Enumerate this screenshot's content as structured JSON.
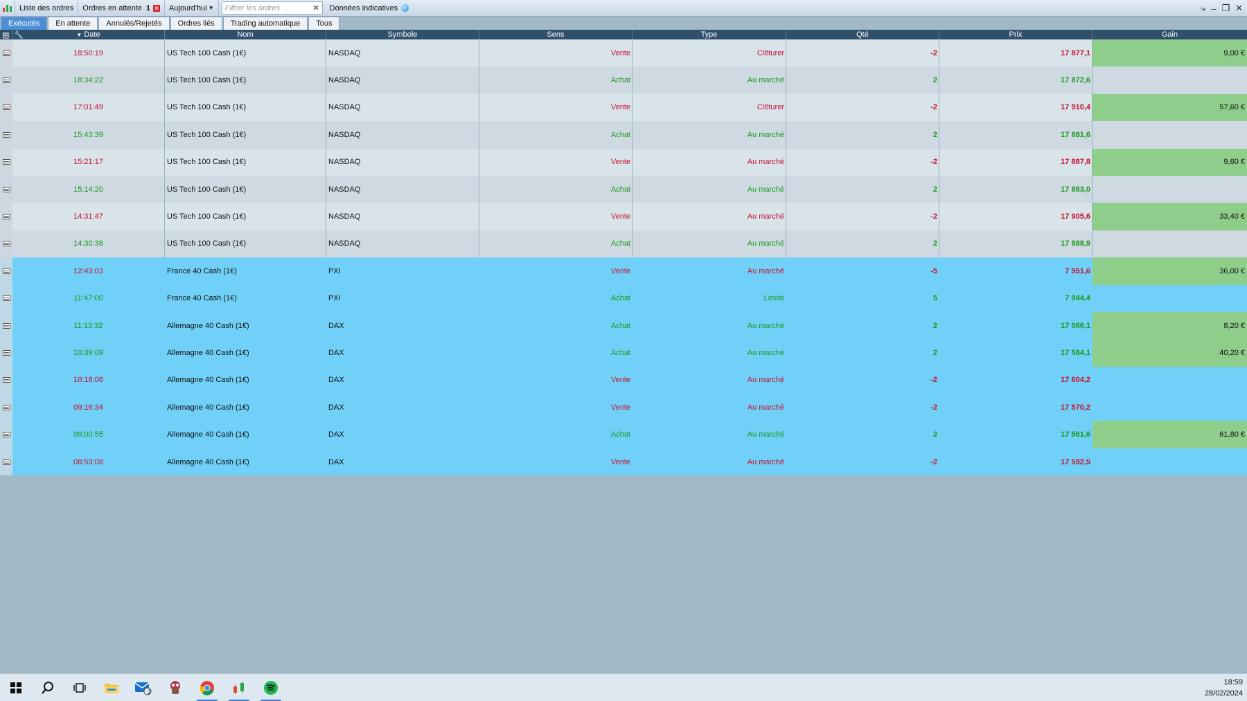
{
  "toolbar": {
    "orders_list": "Liste des ordres",
    "pending_orders": "Ordres en attente",
    "pending_count": "1",
    "period": "Aujourd'hui",
    "filter_placeholder": "Filtrer les ordres ...",
    "data_mode": "Données indicatives"
  },
  "tabs": [
    "Exécutés",
    "En attente",
    "Annulés/Rejetés",
    "Ordres liés",
    "Trading automatique",
    "Tous"
  ],
  "columns": {
    "date": "Date",
    "nom": "Nom",
    "symbole": "Symbole",
    "sens": "Sens",
    "type": "Type",
    "qte": "Qté",
    "prix": "Prix",
    "gain": "Gain"
  },
  "rows": [
    {
      "date": "18:50:19",
      "nom": "US Tech 100 Cash (1€)",
      "symbole": "NASDAQ",
      "sens": "Vente",
      "type": "Clôturer",
      "qte": "-2",
      "prix": "17 877,1",
      "gain": "9,00 €",
      "group": "nasdaq"
    },
    {
      "date": "18:34:22",
      "nom": "US Tech 100 Cash (1€)",
      "symbole": "NASDAQ",
      "sens": "Achat",
      "type": "Au marché",
      "qte": "2",
      "prix": "17 872,6",
      "gain": "",
      "group": "nasdaq"
    },
    {
      "date": "17:01:49",
      "nom": "US Tech 100 Cash (1€)",
      "symbole": "NASDAQ",
      "sens": "Vente",
      "type": "Clôturer",
      "qte": "-2",
      "prix": "17 910,4",
      "gain": "57,60 €",
      "group": "nasdaq"
    },
    {
      "date": "15:43:39",
      "nom": "US Tech 100 Cash (1€)",
      "symbole": "NASDAQ",
      "sens": "Achat",
      "type": "Au marché",
      "qte": "2",
      "prix": "17 881,6",
      "gain": "",
      "group": "nasdaq"
    },
    {
      "date": "15:21:17",
      "nom": "US Tech 100 Cash (1€)",
      "symbole": "NASDAQ",
      "sens": "Vente",
      "type": "Au marché",
      "qte": "-2",
      "prix": "17 887,8",
      "gain": "9,60 €",
      "group": "nasdaq"
    },
    {
      "date": "15:14:20",
      "nom": "US Tech 100 Cash (1€)",
      "symbole": "NASDAQ",
      "sens": "Achat",
      "type": "Au marché",
      "qte": "2",
      "prix": "17 883,0",
      "gain": "",
      "group": "nasdaq"
    },
    {
      "date": "14:31:47",
      "nom": "US Tech 100 Cash (1€)",
      "symbole": "NASDAQ",
      "sens": "Vente",
      "type": "Au marché",
      "qte": "-2",
      "prix": "17 905,6",
      "gain": "33,40 €",
      "group": "nasdaq"
    },
    {
      "date": "14:30:38",
      "nom": "US Tech 100 Cash (1€)",
      "symbole": "NASDAQ",
      "sens": "Achat",
      "type": "Au marché",
      "qte": "2",
      "prix": "17 888,9",
      "gain": "",
      "group": "nasdaq"
    },
    {
      "date": "12:43:03",
      "nom": "France 40 Cash (1€)",
      "symbole": "PXI",
      "sens": "Vente",
      "type": "Au marché",
      "qte": "-5",
      "prix": "7 951,6",
      "gain": "36,00 €",
      "group": "eu"
    },
    {
      "date": "11:47:00",
      "nom": "France 40 Cash (1€)",
      "symbole": "PXI",
      "sens": "Achat",
      "type": "Limite",
      "qte": "5",
      "prix": "7 944,4",
      "gain": "",
      "group": "eu"
    },
    {
      "date": "11:13:32",
      "nom": "Allemagne 40 Cash (1€)",
      "symbole": "DAX",
      "sens": "Achat",
      "type": "Au marché",
      "qte": "2",
      "prix": "17 566,1",
      "gain": "8,20 €",
      "group": "eu"
    },
    {
      "date": "10:39:09",
      "nom": "Allemagne 40 Cash (1€)",
      "symbole": "DAX",
      "sens": "Achat",
      "type": "Au marché",
      "qte": "2",
      "prix": "17 584,1",
      "gain": "40,20 €",
      "group": "eu"
    },
    {
      "date": "10:18:06",
      "nom": "Allemagne 40 Cash (1€)",
      "symbole": "DAX",
      "sens": "Vente",
      "type": "Au marché",
      "qte": "-2",
      "prix": "17 604,2",
      "gain": "",
      "group": "eu"
    },
    {
      "date": "09:16:34",
      "nom": "Allemagne 40 Cash (1€)",
      "symbole": "DAX",
      "sens": "Vente",
      "type": "Au marché",
      "qte": "-2",
      "prix": "17 570,2",
      "gain": "",
      "group": "eu"
    },
    {
      "date": "09:00:55",
      "nom": "Allemagne 40 Cash (1€)",
      "symbole": "DAX",
      "sens": "Achat",
      "type": "Au marché",
      "qte": "2",
      "prix": "17 561,6",
      "gain": "61,80 €",
      "group": "eu"
    },
    {
      "date": "08:53:08",
      "nom": "Allemagne 40 Cash (1€)",
      "symbole": "DAX",
      "sens": "Vente",
      "type": "Au marché",
      "qte": "-2",
      "prix": "17 592,5",
      "gain": "",
      "group": "eu"
    }
  ],
  "colors": {
    "sell": "#c8102e",
    "buy": "#189a18",
    "gain_bg": "#8fcd8a",
    "eu_row_bg": "#70d0f7",
    "header_bg": "#2f4f6b",
    "active_tab": "#4d8fd6"
  },
  "taskbar": {
    "icons": [
      "windows-start-icon",
      "search-icon",
      "task-view-icon",
      "file-explorer-icon",
      "mail-icon",
      "game-icon",
      "chrome-icon",
      "trading-app-icon",
      "spotify-icon"
    ],
    "mail_badge": "2",
    "time": "18:59",
    "date": "28/02/2024"
  }
}
